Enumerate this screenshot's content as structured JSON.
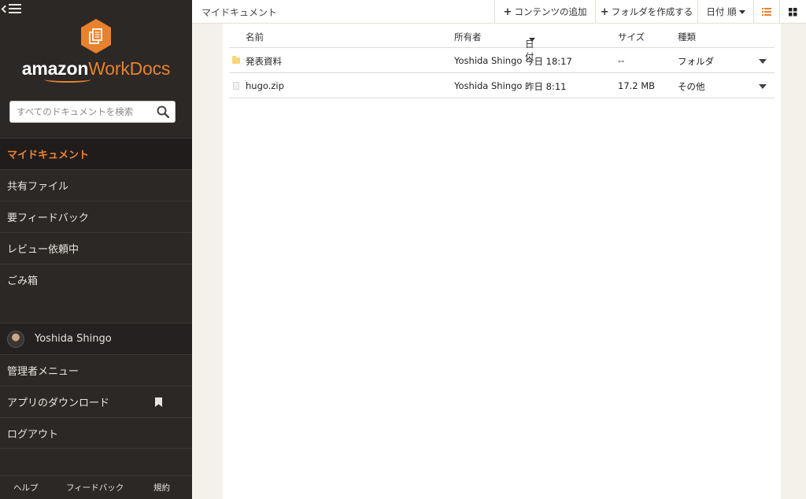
{
  "app": {
    "logo_amazon": "amazon",
    "logo_product": "WorkDocs",
    "brand_color": "#e8822d"
  },
  "search": {
    "placeholder": "すべてのドキュメントを検索"
  },
  "nav": {
    "items": [
      {
        "label": "マイドキュメント",
        "active": true
      },
      {
        "label": "共有ファイル"
      },
      {
        "label": "要フィードバック"
      },
      {
        "label": "レビュー依頼中"
      },
      {
        "label": "ごみ箱"
      }
    ],
    "user": {
      "name": "Yoshida Shingo"
    },
    "secondary": [
      {
        "label": "管理者メニュー"
      },
      {
        "label": "アプリのダウンロード",
        "icon": "bookmark-icon"
      },
      {
        "label": "ログアウト"
      }
    ],
    "footer": [
      "ヘルプ",
      "フィードバック",
      "規約"
    ]
  },
  "toolbar": {
    "breadcrumb": "マイドキュメント",
    "add_content": "コンテンツの追加",
    "create_folder": "フォルダを作成する",
    "sort": "日付 順",
    "view_list": "list-view-icon",
    "view_grid": "grid-view-icon",
    "list_active_color": "#e8822d"
  },
  "table": {
    "columns": [
      "名前",
      "所有者",
      "日付",
      "サイズ",
      "種類"
    ],
    "rows": [
      {
        "icon": "folder-icon",
        "name": "発表資料",
        "owner": "Yoshida Shingo",
        "date": "今日 18:17",
        "size": "--",
        "type": "フォルダ"
      },
      {
        "icon": "file-icon",
        "name": "hugo.zip",
        "owner": "Yoshida Shingo",
        "date": "昨日 8:11",
        "size": "17.2 MB",
        "type": "その他"
      }
    ]
  }
}
